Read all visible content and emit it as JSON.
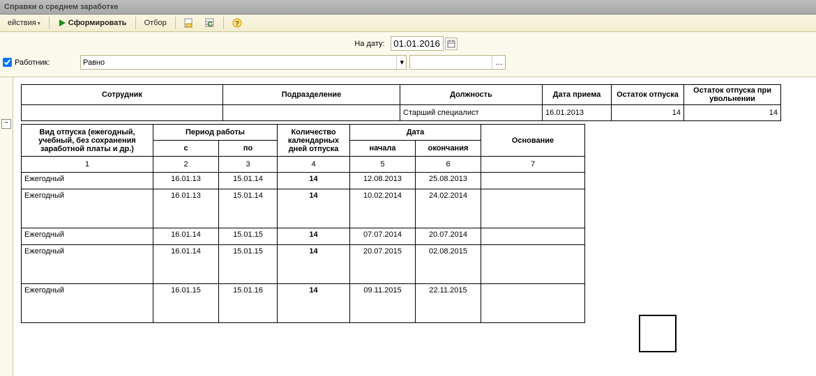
{
  "window": {
    "title": "Справки о среднем заработке"
  },
  "toolbar": {
    "actions": "ействия",
    "form": "Сформировать",
    "filter": "Отбор"
  },
  "filter": {
    "date_label": "На дату:",
    "date_value": "01.01.2016",
    "worker_label": "Работник:",
    "cmp_value": "Равно",
    "worker_value": ""
  },
  "table1": {
    "headers": {
      "emp": "Сотрудник",
      "dept": "Подразделение",
      "pos": "Должность",
      "hire": "Дата приема",
      "rem": "Остаток отпуска",
      "rem_fire": "Остаток отпуска при увольнении"
    },
    "row": {
      "emp": "",
      "dept": "",
      "pos": "Старший специалист",
      "hire": "16.01.2013",
      "rem": "14",
      "rem_fire": "14"
    }
  },
  "table2": {
    "headers": {
      "kind": "Вид отпуска (ежегодный, учебный, без сохранения заработной платы и др.)",
      "period": "Период работы",
      "from": "с",
      "to": "по",
      "days": "Количество календарных дней отпуска",
      "date": "Дата",
      "start": "начала",
      "end": "окончания",
      "basis": "Основание"
    },
    "nums": {
      "c1": "1",
      "c2": "2",
      "c3": "3",
      "c4": "4",
      "c5": "5",
      "c6": "6",
      "c7": "7"
    },
    "rows": [
      {
        "kind": "Ежегодный",
        "from": "16.01.13",
        "to": "15.01.14",
        "days": "14",
        "start": "12.08.2013",
        "end": "25.08.2013",
        "basis": ""
      },
      {
        "kind": "Ежегодный",
        "from": "16.01.13",
        "to": "15.01.14",
        "days": "14",
        "start": "10.02.2014",
        "end": "24.02.2014",
        "basis": ""
      },
      {
        "kind": "Ежегодный",
        "from": "16.01.14",
        "to": "15.01.15",
        "days": "14",
        "start": "07.07.2014",
        "end": "20.07.2014",
        "basis": ""
      },
      {
        "kind": "Ежегодный",
        "from": "16.01.14",
        "to": "15.01.15",
        "days": "14",
        "start": "20.07.2015",
        "end": "02.08.2015",
        "basis": ""
      },
      {
        "kind": "Ежегодный",
        "from": "16.01.15",
        "to": "15.01.16",
        "days": "14",
        "start": "09.11.2015",
        "end": "22.11.2015",
        "basis": ""
      }
    ]
  }
}
